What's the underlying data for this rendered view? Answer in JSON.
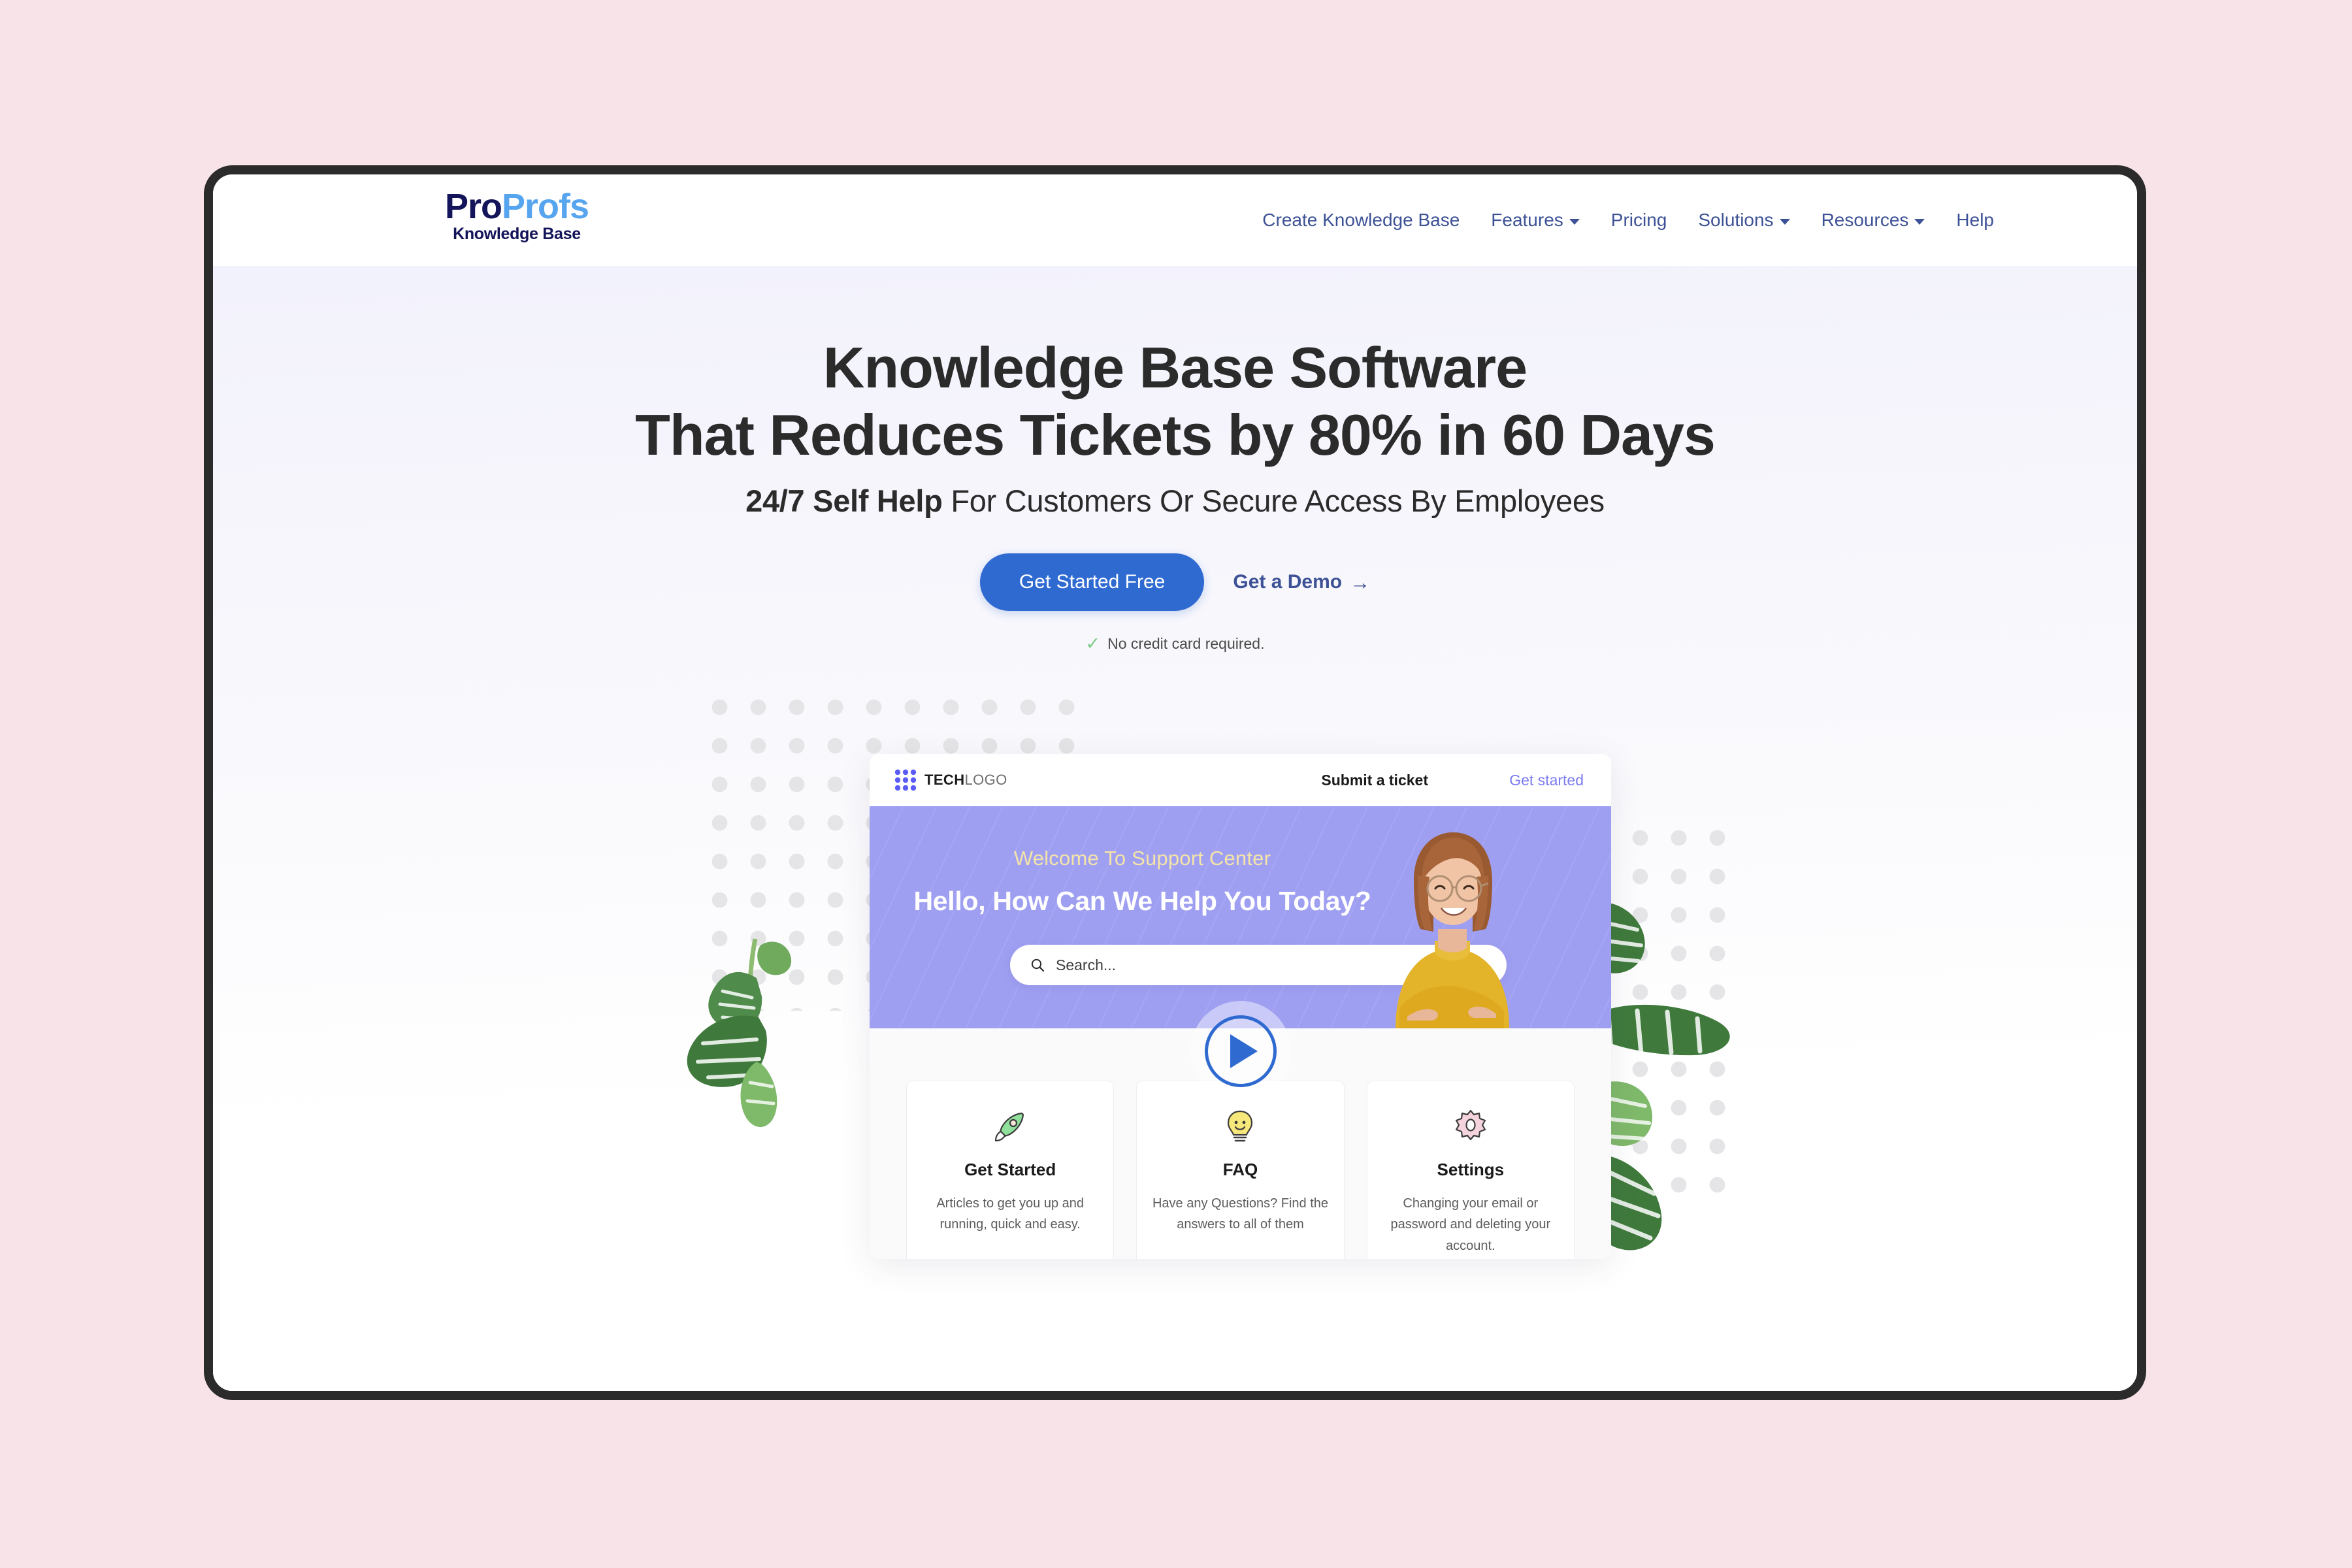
{
  "brand": {
    "name_part1": "Pro",
    "name_part2": "Profs",
    "subtitle": "Knowledge Base"
  },
  "nav": {
    "items": [
      {
        "label": "Create Knowledge Base",
        "has_dropdown": false
      },
      {
        "label": "Features",
        "has_dropdown": true
      },
      {
        "label": "Pricing",
        "has_dropdown": false
      },
      {
        "label": "Solutions",
        "has_dropdown": true
      },
      {
        "label": "Resources",
        "has_dropdown": true
      },
      {
        "label": "Help",
        "has_dropdown": false
      }
    ]
  },
  "hero": {
    "headline_line1": "Knowledge Base Software",
    "headline_line2": "That Reduces Tickets by 80% in 60 Days",
    "subhead_strong": "24/7 Self Help",
    "subhead_rest": " For Customers Or Secure Access By Employees",
    "cta_primary": "Get Started Free",
    "cta_secondary": "Get a Demo",
    "cta_secondary_arrow": "→",
    "note_check": "✓",
    "note": "No credit card required."
  },
  "mockup": {
    "logo_bold": "TECH",
    "logo_light": "LOGO",
    "submit_ticket": "Submit a ticket",
    "get_started": "Get started",
    "welcome": "Welcome To Support Center",
    "hello": "Hello, How Can We Help You Today?",
    "search_placeholder": "Search...",
    "cards": [
      {
        "icon": "rocket-icon",
        "title": "Get Started",
        "desc": "Articles to get you up and running, quick and easy."
      },
      {
        "icon": "lightbulb-icon",
        "title": "FAQ",
        "desc": "Have any Questions? Find the answers to all of them"
      },
      {
        "icon": "gear-icon",
        "title": "Settings",
        "desc": "Changing your email or password and deleting your account."
      }
    ]
  },
  "colors": {
    "page_background": "#f8e4e8",
    "frame": "#2b2b2b",
    "nav_text": "#3d5296",
    "primary_button": "#2f6ad1",
    "banner_purple": "#9f9ff2",
    "welcome_yellow": "#f4e4a8",
    "mockup_link_purple": "#7b7bf0",
    "check_green": "#7ec98a",
    "logo_navy": "#14145a",
    "logo_blue": "#57a5ef"
  }
}
